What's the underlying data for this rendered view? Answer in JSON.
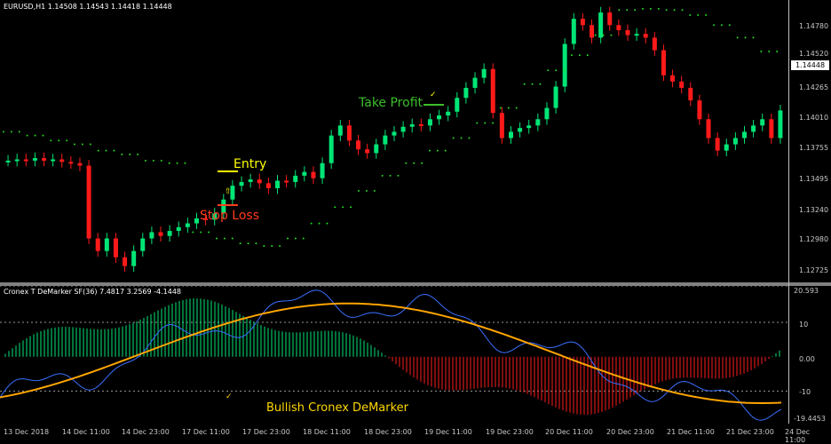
{
  "chart_title": "EURUSD,H1  1.14508 1.14543 1.14418 1.14448",
  "indicator_title": "Cronex T DeMarker SF(36) 7.4817 3.2569 -4.1448",
  "current_price": "1.14448",
  "price_labels": [
    "1.14780",
    "1.14520",
    "1.14265",
    "1.14010",
    "1.13755",
    "1.13495",
    "1.13240",
    "1.12980",
    "1.12725"
  ],
  "indicator_labels": [
    "20.593",
    "10",
    "0.00",
    "-10",
    "-19.4453"
  ],
  "time_labels": [
    "13 Dec 2018",
    "14 Dec 11:00",
    "14 Dec 23:00",
    "17 Dec 11:00",
    "17 Dec 23:00",
    "18 Dec 11:00",
    "18 Dec 23:00",
    "19 Dec 11:00",
    "19 Dec 23:00",
    "20 Dec 11:00",
    "20 Dec 23:00",
    "21 Dec 11:00",
    "21 Dec 23:00",
    "24 Dec 11:00"
  ],
  "annotations": {
    "entry": "Entry",
    "stop_loss": "Stop Loss",
    "take_profit": "Take Profit",
    "signal": "Bullish Cronex DeMarker"
  },
  "colors": {
    "bull": "#00e676",
    "bear": "#ff1a1a",
    "parabolic": "#22dd22",
    "fast_line": "#3a6fff",
    "slow_line": "#ffa500",
    "entry": "#ffff00",
    "stop_loss": "#ff3b1f",
    "take_profit": "#3cbf2a",
    "signal": "#ffd700"
  },
  "chart_data": {
    "type": "candlestick",
    "symbol": "EURUSD",
    "timeframe": "H1",
    "ohlc": [
      1.14508,
      1.14543,
      1.14418,
      1.14448
    ],
    "ylim": [
      1.1265,
      1.149
    ],
    "y_ticks": [
      1.1478,
      1.1452,
      1.14265,
      1.1401,
      1.13755,
      1.13495,
      1.1324,
      1.1298,
      1.12725
    ],
    "closes": [
      1.1362,
      1.1363,
      1.1362,
      1.1364,
      1.1362,
      1.1363,
      1.1361,
      1.136,
      1.1358,
      1.13,
      1.129,
      1.13,
      1.1285,
      1.1278,
      1.129,
      1.13,
      1.1305,
      1.1302,
      1.1306,
      1.1309,
      1.1312,
      1.1316,
      1.1315,
      1.132,
      1.1331,
      1.1342,
      1.1345,
      1.1347,
      1.1344,
      1.134,
      1.1346,
      1.1345,
      1.135,
      1.1353,
      1.1348,
      1.136,
      1.1382,
      1.139,
      1.1378,
      1.1371,
      1.1368,
      1.1375,
      1.1382,
      1.1385,
      1.1389,
      1.1391,
      1.139,
      1.1395,
      1.1398,
      1.1401,
      1.1412,
      1.142,
      1.1428,
      1.1435,
      1.14,
      1.138,
      1.1385,
      1.1388,
      1.139,
      1.1395,
      1.1404,
      1.1421,
      1.1455,
      1.1475,
      1.147,
      1.146,
      1.148,
      1.147,
      1.1466,
      1.1462,
      1.1463,
      1.146,
      1.145,
      1.143,
      1.1425,
      1.142,
      1.141,
      1.1395,
      1.138,
      1.137,
      1.1375,
      1.138,
      1.1385,
      1.139,
      1.1395,
      1.138,
      1.1402
    ],
    "parabolic_sar": [
      1.1385,
      1.1382,
      1.1378,
      1.1375,
      1.137,
      1.1367,
      1.1362,
      1.136,
      1.1305,
      1.13,
      1.1296,
      1.1294,
      1.13,
      1.1312,
      1.1325,
      1.1338,
      1.135,
      1.136,
      1.137,
      1.138,
      1.1392,
      1.1404,
      1.1423,
      1.1434,
      1.1446,
      1.1462,
      1.1482,
      1.1483,
      1.1482,
      1.1478,
      1.147,
      1.146,
      1.1449
    ],
    "indicator": {
      "name": "Cronex T DeMarker SF(36)",
      "values": [
        7.4817,
        3.2569,
        -4.1448
      ],
      "ylim": [
        -19.4453,
        20.593
      ],
      "levels": [
        20.593,
        10,
        0,
        -10,
        -19.4453
      ]
    }
  }
}
